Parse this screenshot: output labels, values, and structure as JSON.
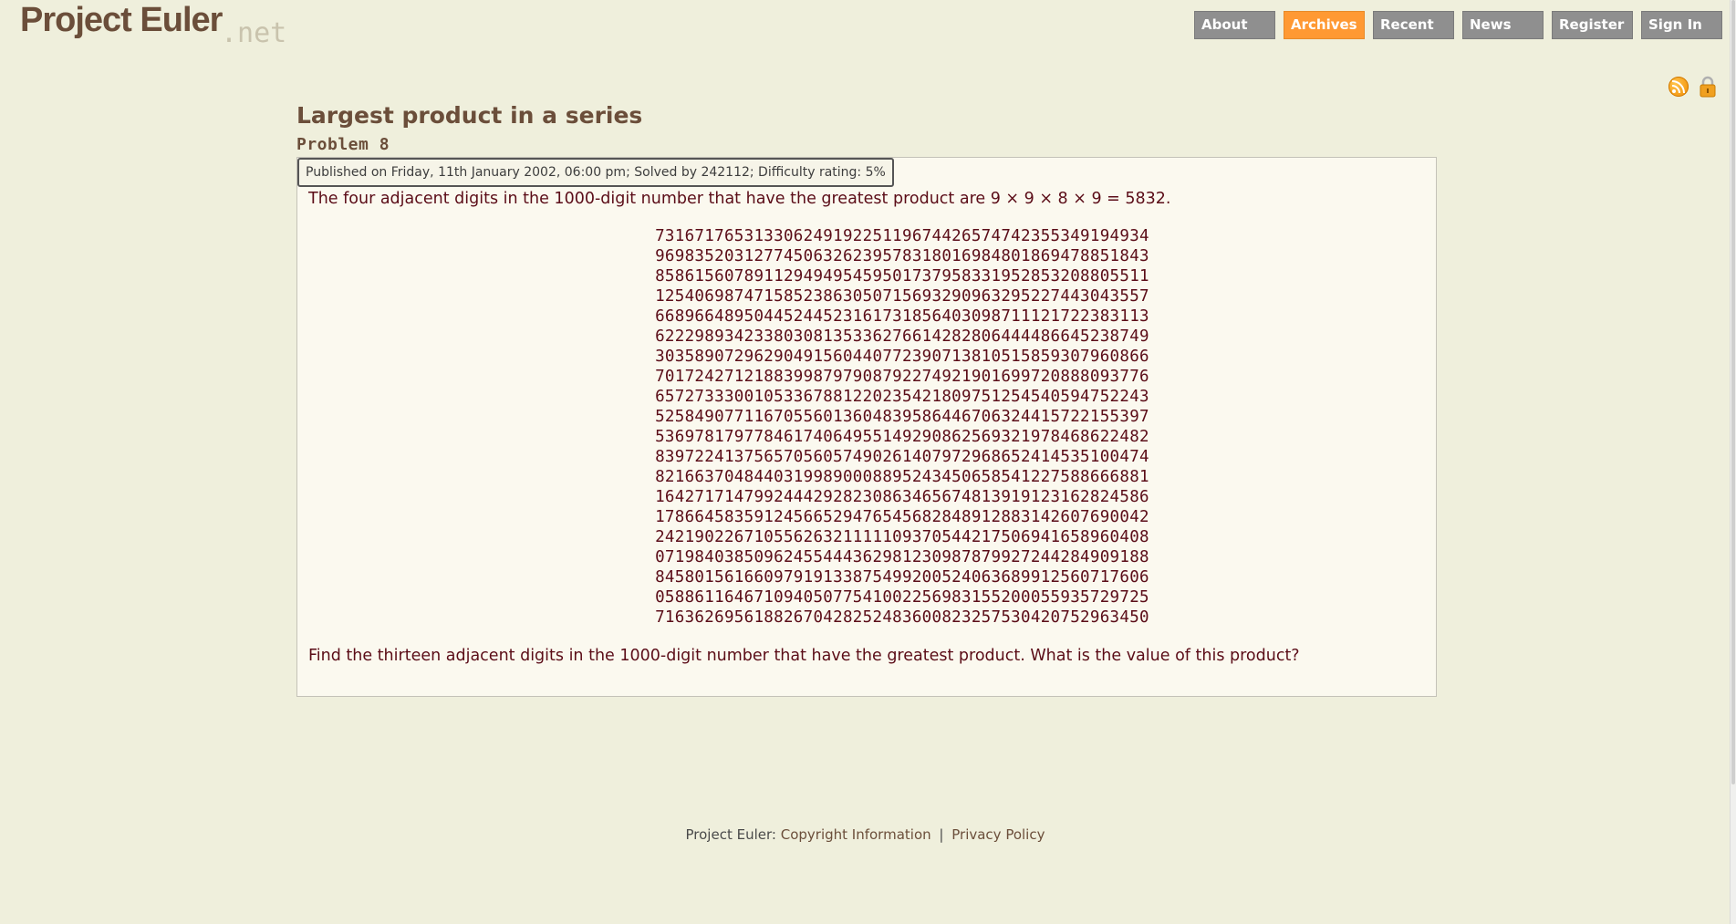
{
  "header": {
    "logo_main": "Project Euler",
    "logo_net": ".net"
  },
  "nav": {
    "items": [
      {
        "label": "About"
      },
      {
        "label": "Archives"
      },
      {
        "label": "Recent"
      },
      {
        "label": "News"
      },
      {
        "label": "Register"
      },
      {
        "label": "Sign In"
      }
    ],
    "active": "Archives"
  },
  "icons": {
    "rss": "rss-feed-icon",
    "lock": "lock-icon"
  },
  "colors": {
    "background": "#efefdc",
    "accent": "#ff9933",
    "nav_inactive": "#8f8f8f",
    "text_brown": "#6b4e3a",
    "problem_text": "#5b0d18"
  },
  "problem": {
    "title": "Largest product in a series",
    "subtitle": "Problem 8",
    "info": "Published on Friday, 11th January 2002, 06:00 pm; Solved by 242112; Difficulty rating: 5%",
    "intro": "The four adjacent digits in the 1000-digit number that have the greatest product are 9 × 9 × 8 × 9 = 5832.",
    "digits": [
      "73167176531330624919225119674426574742355349194934",
      "96983520312774506326239578318016984801869478851843",
      "85861560789112949495459501737958331952853208805511",
      "12540698747158523863050715693290963295227443043557",
      "66896648950445244523161731856403098711121722383113",
      "62229893423380308135336276614282806444486645238749",
      "30358907296290491560440772390713810515859307960866",
      "70172427121883998797908792274921901699720888093776",
      "65727333001053367881220235421809751254540594752243",
      "52584907711670556013604839586446706324415722155397",
      "53697817977846174064955149290862569321978468622482",
      "83972241375657056057490261407972968652414535100474",
      "82166370484403199890008895243450658541227588666881",
      "16427171479924442928230863465674813919123162824586",
      "17866458359124566529476545682848912883142607690042",
      "24219022671055626321111109370544217506941658960408",
      "07198403850962455444362981230987879927244284909188",
      "84580156166097919133875499200524063689912560717606",
      "05886116467109405077541002256983155200055935729725",
      "71636269561882670428252483600823257530420752963450"
    ],
    "question": "Find the thirteen adjacent digits in the 1000-digit number that have the greatest product. What is the value of this product?"
  },
  "footer": {
    "prefix": "Project Euler:",
    "copyright": "Copyright Information",
    "separator": "|",
    "privacy": "Privacy Policy"
  }
}
